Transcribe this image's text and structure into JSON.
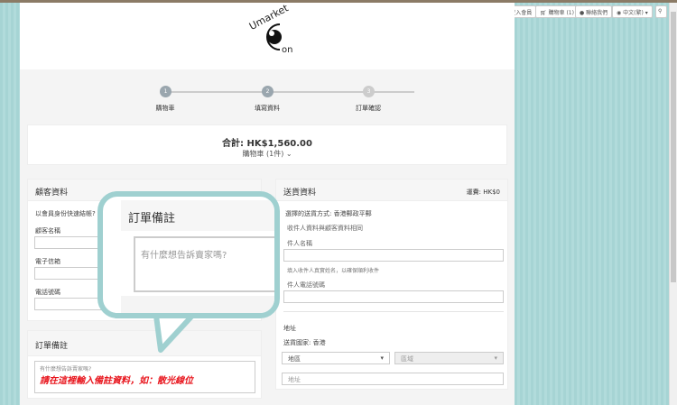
{
  "topnav": {
    "login": "登入會員",
    "cart": "購物車 (1)",
    "contact": "聯絡我們",
    "language": "中文(繁)"
  },
  "logo": {
    "text": "Umarket Con"
  },
  "steps": [
    {
      "num": "1",
      "label": "購物車"
    },
    {
      "num": "2",
      "label": "填寫資料"
    },
    {
      "num": "3",
      "label": "訂單確認"
    }
  ],
  "summary": {
    "total": "合計: HK$1,560.00",
    "cart": "購物車 (1件)"
  },
  "customer": {
    "title": "顧客資料",
    "member_prompt": "以會員身份快速結帳?",
    "name_label": "顧客名稱",
    "email_label": "電子信箱",
    "phone_label": "電話號碼"
  },
  "notes": {
    "title": "訂單備註",
    "placeholder": "有什麼想告訴賣家嗎?",
    "annotation": "請在這裡輸入備註資料，如：散光線位"
  },
  "callout": {
    "title": "訂單備註",
    "placeholder": "有什麼想告訴賣家嗎?"
  },
  "shipping": {
    "title": "送貨資料",
    "fee": "運費: HK$0",
    "method": "選擇的送貨方式: 香港郵政平郵",
    "same_as": "收件人資料與顧客資料相同",
    "recipient_name_label": "件人名稱",
    "recipient_hint": "填入收件人真實姓名，以確保順利收件",
    "recipient_phone_label": "件人電話號碼",
    "address_title": "地址",
    "country": "送貨國家: 香港",
    "region_placeholder": "地區",
    "district_placeholder": "區域",
    "address_placeholder": "地址"
  }
}
